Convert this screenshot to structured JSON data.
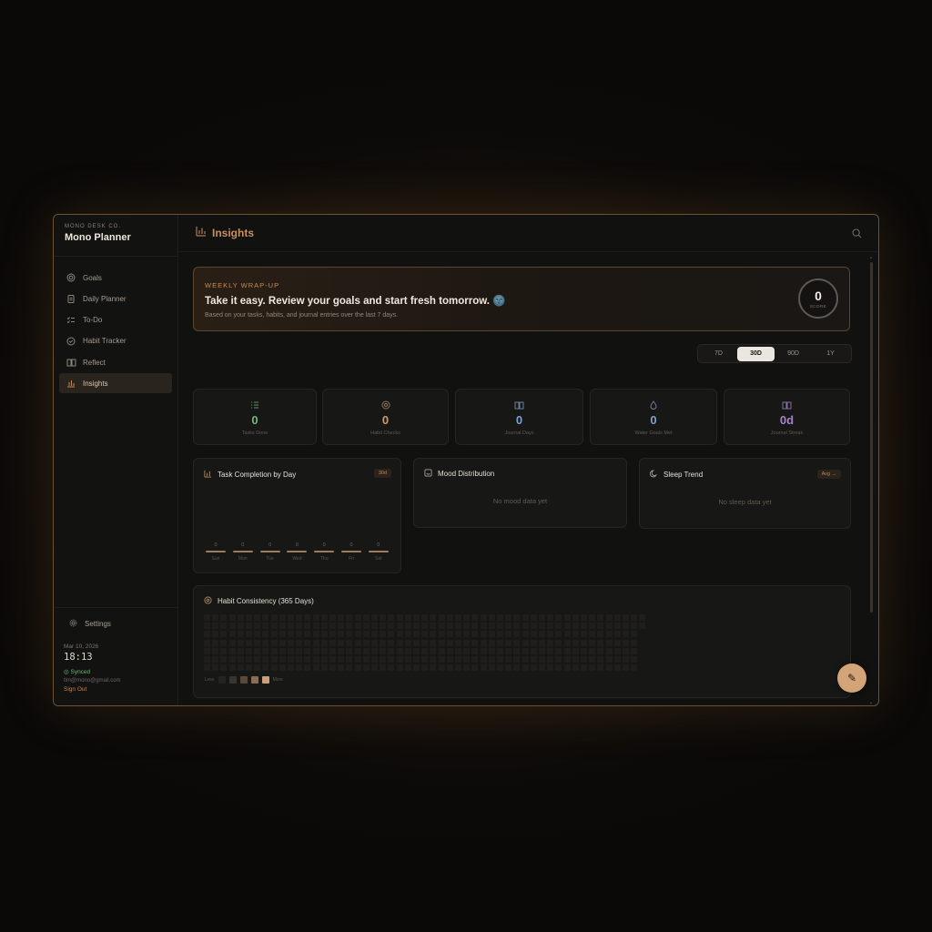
{
  "brand": {
    "company": "MONO DESK CO.",
    "name": "Mono Planner"
  },
  "nav": [
    {
      "label": "Goals",
      "icon": "target-icon"
    },
    {
      "label": "Daily Planner",
      "icon": "clipboard-icon"
    },
    {
      "label": "To-Do",
      "icon": "checklist-icon"
    },
    {
      "label": "Habit Tracker",
      "icon": "check-circle-icon"
    },
    {
      "label": "Reflect",
      "icon": "book-icon"
    },
    {
      "label": "Insights",
      "icon": "bar-chart-icon",
      "active": true
    }
  ],
  "footer": {
    "settings_label": "Settings",
    "date": "Mar 10, 2026",
    "time": "18:13",
    "sync_status": "Synced",
    "email": "tim@mono@gmail.com",
    "sign_out": "Sign Out"
  },
  "header": {
    "title": "Insights"
  },
  "weekly_wrap": {
    "kicker": "WEEKLY WRAP-UP",
    "headline": "Take it easy. Review your goals and start fresh tomorrow.",
    "emoji": "🌚",
    "subtext": "Based on your tasks, habits, and journal entries over the last 7 days.",
    "score_value": "0",
    "score_label": "SCORE"
  },
  "ranges": {
    "options": [
      "7D",
      "30D",
      "90D",
      "1Y"
    ],
    "selected": "30D"
  },
  "stats": [
    {
      "value": "0",
      "label": "Tasks Done",
      "color": "#6fb67a",
      "icon": "list-icon"
    },
    {
      "value": "0",
      "label": "Habit Checks",
      "color": "#d89a62",
      "icon": "target-icon"
    },
    {
      "value": "0",
      "label": "Journal Days",
      "color": "#7f9fd6",
      "icon": "book-icon"
    },
    {
      "value": "0",
      "label": "Water Goals Met",
      "color": "#7f9fd6",
      "icon": "droplet-icon"
    },
    {
      "value": "0d",
      "label": "Journal Streak",
      "color": "#a883c9",
      "icon": "book-icon"
    }
  ],
  "task_card": {
    "title": "Task Completion by Day",
    "badge": "30d",
    "chart_data": {
      "type": "bar",
      "categories": [
        "Sun",
        "Mon",
        "Tue",
        "Wed",
        "Thu",
        "Fri",
        "Sat"
      ],
      "values": [
        0,
        0,
        0,
        0,
        0,
        0,
        0
      ]
    }
  },
  "mood_card": {
    "title": "Mood Distribution",
    "empty": "No mood data yet"
  },
  "sleep_card": {
    "title": "Sleep Trend",
    "badge": "Avg →",
    "empty": "No sleep data yet"
  },
  "habit_card": {
    "title": "Habit Consistency (365 Days)",
    "legend_less": "Less",
    "legend_more": "More",
    "legend_colors": [
      "#242321",
      "#3a3430",
      "#5a4a3e",
      "#8a6c54",
      "#c9a07a"
    ]
  }
}
